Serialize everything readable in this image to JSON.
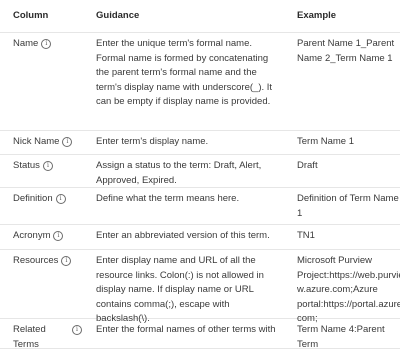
{
  "headers": {
    "column": "Column",
    "guidance": "Guidance",
    "example": "Example"
  },
  "rows": [
    {
      "column": "Name",
      "guidance": "Enter the unique term's formal name. Formal name is formed by concatenating the parent term's formal name and the term's display name with underscore(_). It can be empty if display name is provided.",
      "example": "Parent Name 1_Parent Name 2_Term Name 1"
    },
    {
      "column": "Nick Name",
      "guidance": "Enter term's display name.",
      "example": "Term Name 1"
    },
    {
      "column": "Status",
      "guidance": "Assign a status to the term: Draft, Alert, Approved, Expired.",
      "example": "Draft"
    },
    {
      "column": "Definition",
      "guidance": "Define what the term means here.",
      "example": "Definition of Term Name 1"
    },
    {
      "column": "Acronym",
      "guidance": "Enter an abbreviated version of this term.",
      "example": "TN1"
    },
    {
      "column": "Resources",
      "guidance": "Enter display name and URL of all the resource links. Colon(:) is not allowed in display name. If display name or URL contains comma(;), escape with backslash(\\).",
      "example_lines": [
        "Microsoft Purview",
        "Project:https://web.purview",
        "w.azure.com;Azure",
        "portal:https://portal.azure.",
        "com;"
      ]
    },
    {
      "column": "Related Terms",
      "guidance": "Enter the formal names of other terms with",
      "example": "Term Name 4:Parent Term"
    }
  ],
  "icons": {
    "info": "info-icon"
  }
}
